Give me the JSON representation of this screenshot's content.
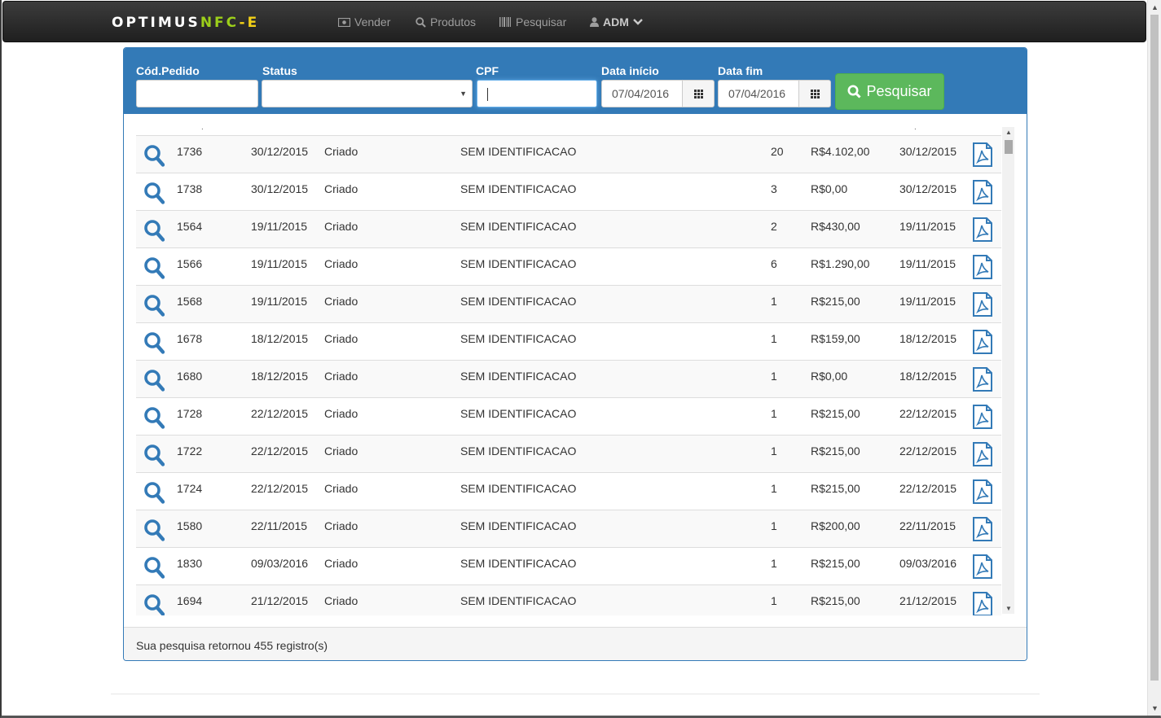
{
  "brand": {
    "part1": "OPTIMUS",
    "part2": "NFC",
    "part3": "-E"
  },
  "nav": {
    "vender": "Vender",
    "produtos": "Produtos",
    "pesquisar": "Pesquisar",
    "user": "ADM"
  },
  "filters": {
    "cod_pedido_label": "Cód.Pedido",
    "cod_pedido_value": "",
    "status_label": "Status",
    "status_value": "",
    "cpf_label": "CPF",
    "cpf_value": "",
    "data_inicio_label": "Data início",
    "data_inicio_value": "07/04/2016",
    "data_fim_label": "Data fim",
    "data_fim_value": "07/04/2016",
    "search_button": "Pesquisar"
  },
  "rows": [
    {
      "id": "1736",
      "date": "30/12/2015",
      "status": "Criado",
      "client": "SEM IDENTIFICACAO",
      "qty": "20",
      "total": "R$4.102,00",
      "date2": "30/12/2015"
    },
    {
      "id": "1738",
      "date": "30/12/2015",
      "status": "Criado",
      "client": "SEM IDENTIFICACAO",
      "qty": "3",
      "total": "R$0,00",
      "date2": "30/12/2015"
    },
    {
      "id": "1564",
      "date": "19/11/2015",
      "status": "Criado",
      "client": "SEM IDENTIFICACAO",
      "qty": "2",
      "total": "R$430,00",
      "date2": "19/11/2015"
    },
    {
      "id": "1566",
      "date": "19/11/2015",
      "status": "Criado",
      "client": "SEM IDENTIFICACAO",
      "qty": "6",
      "total": "R$1.290,00",
      "date2": "19/11/2015"
    },
    {
      "id": "1568",
      "date": "19/11/2015",
      "status": "Criado",
      "client": "SEM IDENTIFICACAO",
      "qty": "1",
      "total": "R$215,00",
      "date2": "19/11/2015"
    },
    {
      "id": "1678",
      "date": "18/12/2015",
      "status": "Criado",
      "client": "SEM IDENTIFICACAO",
      "qty": "1",
      "total": "R$159,00",
      "date2": "18/12/2015"
    },
    {
      "id": "1680",
      "date": "18/12/2015",
      "status": "Criado",
      "client": "SEM IDENTIFICACAO",
      "qty": "1",
      "total": "R$0,00",
      "date2": "18/12/2015"
    },
    {
      "id": "1728",
      "date": "22/12/2015",
      "status": "Criado",
      "client": "SEM IDENTIFICACAO",
      "qty": "1",
      "total": "R$215,00",
      "date2": "22/12/2015"
    },
    {
      "id": "1722",
      "date": "22/12/2015",
      "status": "Criado",
      "client": "SEM IDENTIFICACAO",
      "qty": "1",
      "total": "R$215,00",
      "date2": "22/12/2015"
    },
    {
      "id": "1724",
      "date": "22/12/2015",
      "status": "Criado",
      "client": "SEM IDENTIFICACAO",
      "qty": "1",
      "total": "R$215,00",
      "date2": "22/12/2015"
    },
    {
      "id": "1580",
      "date": "22/11/2015",
      "status": "Criado",
      "client": "SEM IDENTIFICACAO",
      "qty": "1",
      "total": "R$200,00",
      "date2": "22/11/2015"
    },
    {
      "id": "1830",
      "date": "09/03/2016",
      "status": "Criado",
      "client": "SEM IDENTIFICACAO",
      "qty": "1",
      "total": "R$215,00",
      "date2": "09/03/2016"
    },
    {
      "id": "1694",
      "date": "21/12/2015",
      "status": "Criado",
      "client": "SEM IDENTIFICACAO",
      "qty": "1",
      "total": "R$215,00",
      "date2": "21/12/2015"
    }
  ],
  "footer": {
    "result_text": "Sua pesquisa retornou 455 registro(s)"
  },
  "colors": {
    "primary": "#337ab7",
    "success": "#5cb85c",
    "navbar": "#222222",
    "brand_green": "#9ccf1a",
    "brand_yellow": "#f2d017"
  },
  "icons": {
    "row_view": "magnifier-icon",
    "row_pdf": "pdf-icon",
    "search": "search-icon",
    "calendar": "calendar-grid-icon",
    "user": "user-icon"
  }
}
